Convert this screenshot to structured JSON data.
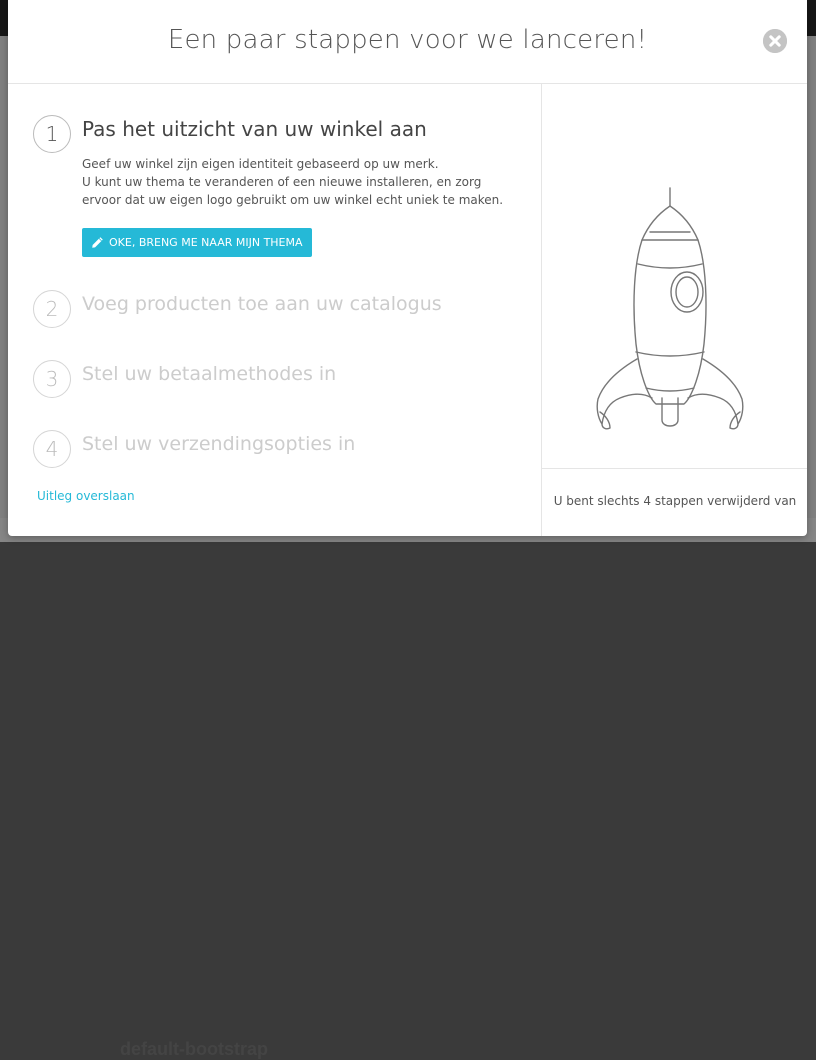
{
  "modal": {
    "title": "Een paar stappen voor we lanceren!",
    "close_icon": "close-circle-icon"
  },
  "steps": [
    {
      "number": "1",
      "title": "Pas het uitzicht van uw winkel aan",
      "active": true,
      "description": [
        "Geef uw winkel zijn eigen identiteit gebaseerd op uw merk.",
        "U kunt uw thema te veranderen of een nieuwe installeren, en zorg ervoor dat uw eigen logo gebruikt om uw winkel echt uniek te maken."
      ],
      "button_label": "OKE, BRENG ME NAAR MIJN THEMA",
      "button_icon": "pencil-icon"
    },
    {
      "number": "2",
      "title": "Voeg producten toe aan uw catalogus",
      "active": false
    },
    {
      "number": "3",
      "title": "Stel uw betaalmethodes in",
      "active": false
    },
    {
      "number": "4",
      "title": "Stel uw verzendingsopties in",
      "active": false
    }
  ],
  "skip_link": "Uitleg overslaan",
  "right_panel": {
    "illustration": "rocket-illustration",
    "footer_text": "U bent slechts 4 stappen verwijderd van"
  },
  "background": {
    "bottom_text": "default-bootstrap"
  },
  "colors": {
    "accent": "#25b9d7",
    "text": "#555555",
    "muted": "#cccccc"
  }
}
